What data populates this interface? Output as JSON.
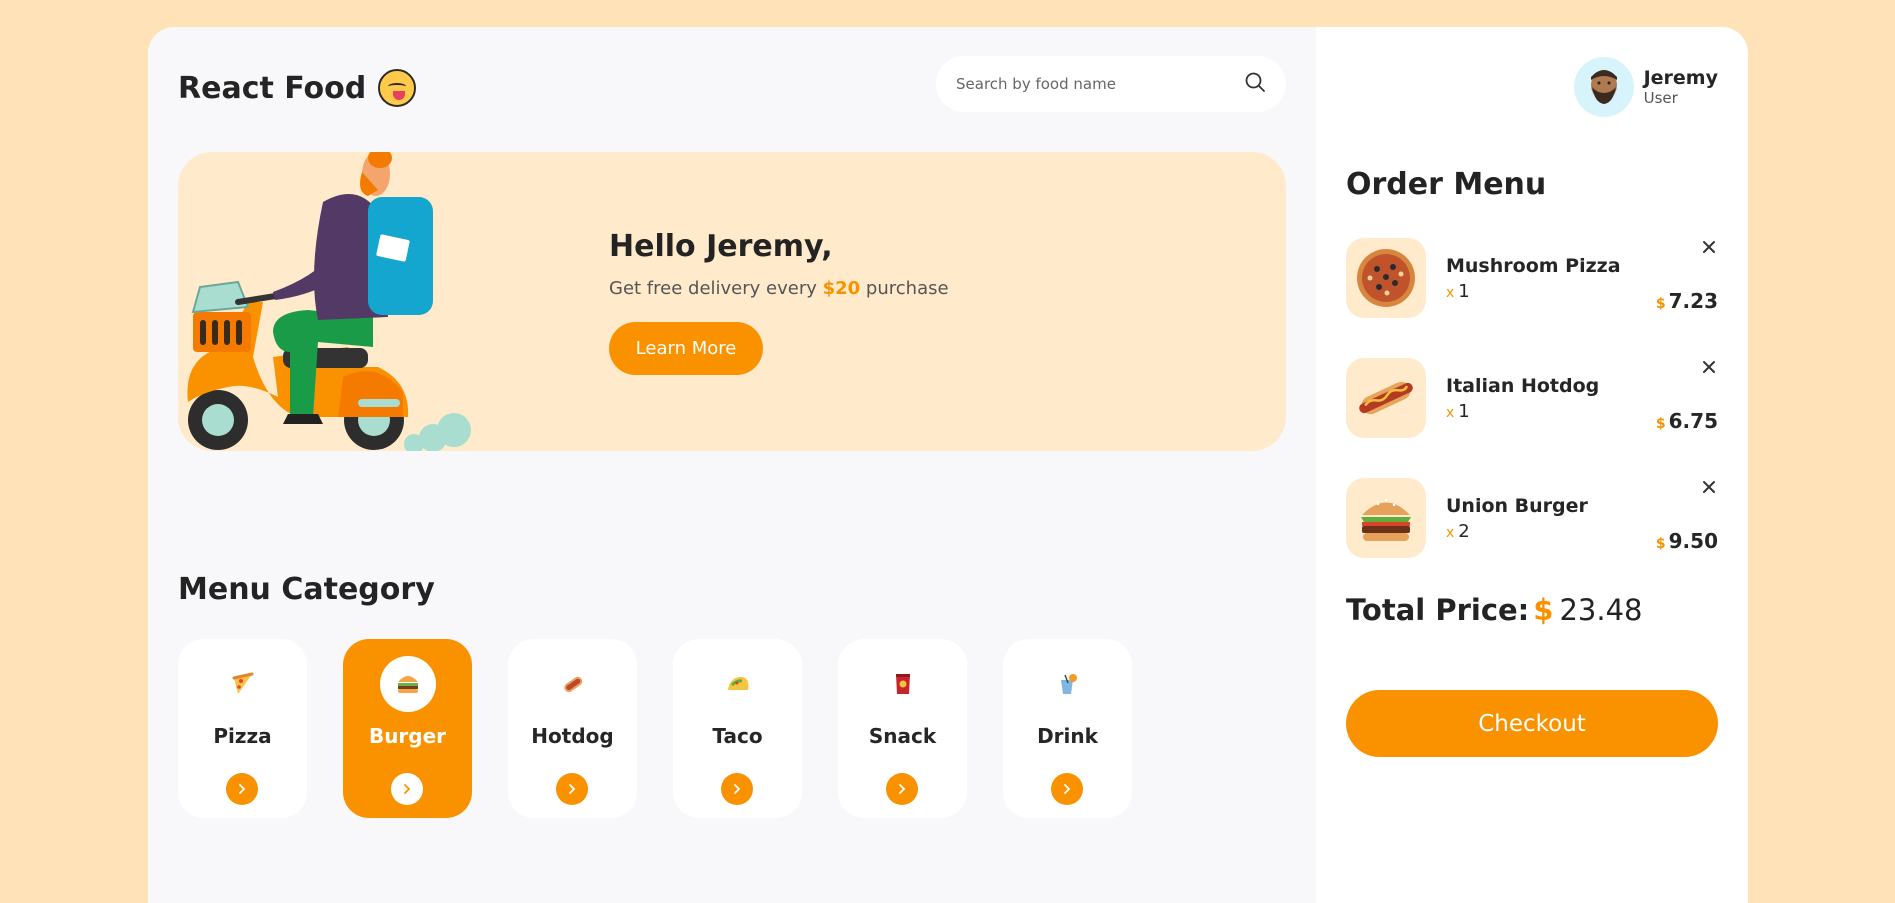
{
  "header": {
    "app_title": "React Food",
    "logo_icon": "yummy-face-emoji-icon"
  },
  "search": {
    "placeholder": "Search by food name",
    "value": "",
    "icon": "search-icon"
  },
  "banner": {
    "greeting": "Hello Jeremy,",
    "promo_before": "Get free delivery every",
    "promo_price": "$20",
    "promo_after": "purchase",
    "button_label": "Learn More",
    "illustration": "scooter-delivery-illustration"
  },
  "category_section": {
    "heading": "Menu Category",
    "items": [
      {
        "label": "Pizza",
        "icon": "pizza-icon",
        "active": false
      },
      {
        "label": "Burger",
        "icon": "burger-icon",
        "active": true
      },
      {
        "label": "Hotdog",
        "icon": "hotdog-icon",
        "active": false
      },
      {
        "label": "Taco",
        "icon": "taco-icon",
        "active": false
      },
      {
        "label": "Snack",
        "icon": "snack-icon",
        "active": false
      },
      {
        "label": "Drink",
        "icon": "drink-icon",
        "active": false
      }
    ]
  },
  "profile": {
    "name": "Jeremy",
    "role": "User",
    "avatar_icon": "bearded-man-avatar-icon"
  },
  "order": {
    "heading": "Order Menu",
    "items": [
      {
        "name": "Mushroom Pizza",
        "qty_prefix": "x",
        "qty": "1",
        "currency": "$",
        "price": "7.23",
        "icon": "pizza-icon"
      },
      {
        "name": "Italian Hotdog",
        "qty_prefix": "x",
        "qty": "1",
        "currency": "$",
        "price": "6.75",
        "icon": "hotdog-icon"
      },
      {
        "name": "Union Burger",
        "qty_prefix": "x",
        "qty": "2",
        "currency": "$",
        "price": "9.50",
        "icon": "burger-icon"
      }
    ],
    "total_label": "Total Price:",
    "total_currency": "$",
    "total_value": "23.48",
    "checkout_label": "Checkout"
  },
  "colors": {
    "accent": "#fa9200",
    "page_background": "#ffe2b8",
    "banner_background": "#ffeacb"
  }
}
